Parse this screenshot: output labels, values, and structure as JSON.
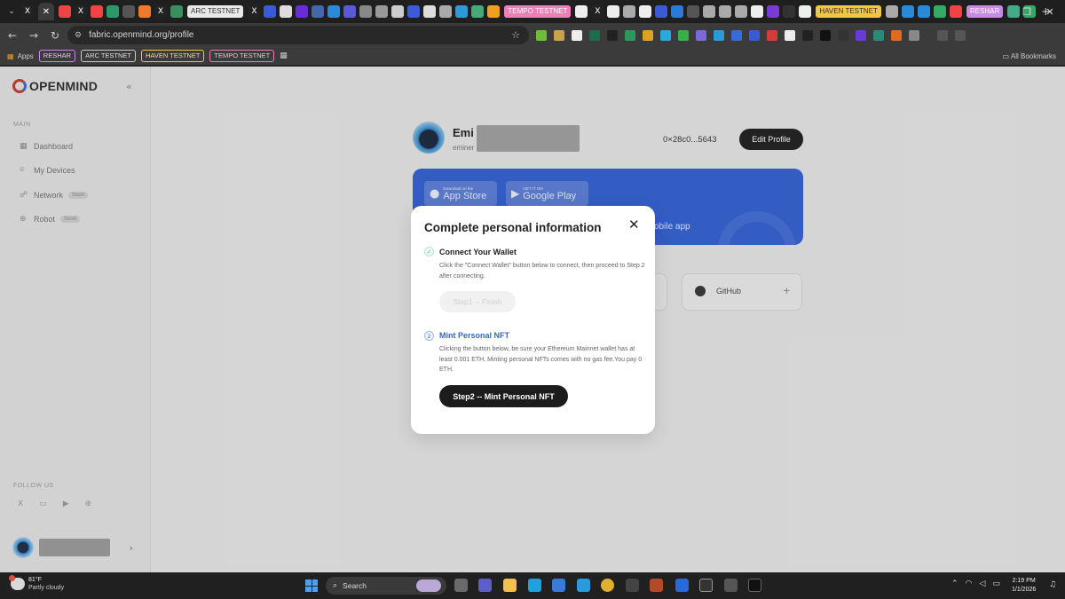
{
  "browser": {
    "tab_chips": [
      {
        "label": "ARC TESTNET",
        "bg": "#e8e8e8",
        "fg": "#333"
      },
      {
        "label": "TEMPO TESTNET",
        "bg": "#ee7fb6",
        "fg": "#fff"
      },
      {
        "label": "HAVEN TESTNET",
        "bg": "#f2c744",
        "fg": "#333"
      },
      {
        "label": "RESHAR",
        "bg": "#c98ae6",
        "fg": "#fff"
      }
    ],
    "new_tab": "+",
    "window_controls": {
      "minimize": "—",
      "restore": "❐",
      "close": "✕"
    },
    "url": "fabric.openmind.org/profile",
    "bookmarks": {
      "apps_label": "Apps",
      "items": [
        {
          "label": "RESHAR",
          "color": "#c98ae6"
        },
        {
          "label": "ARC TESTNET",
          "color": "#cccccc"
        },
        {
          "label": "HAVEN TESTNET",
          "color": "#f2c744"
        },
        {
          "label": "TEMPO TESTNET",
          "color": "#ee7fb6"
        }
      ],
      "all_bookmarks": "All Bookmarks"
    }
  },
  "sidebar": {
    "logo_text": "OPENMIND",
    "section_main": "MAIN",
    "items": [
      {
        "label": "Dashboard",
        "icon": "grid-icon",
        "badge": ""
      },
      {
        "label": "My Devices",
        "icon": "devices-icon",
        "badge": ""
      },
      {
        "label": "Network",
        "icon": "network-icon",
        "badge": "Soon"
      },
      {
        "label": "Robot",
        "icon": "robot-icon",
        "badge": "Soon"
      }
    ],
    "section_follow": "FOLLOW US"
  },
  "profile": {
    "name_visible": "Emi",
    "handle_visible": "eminer",
    "wallet_address": "0×28c0...5643",
    "edit_button": "Edit Profile"
  },
  "banner": {
    "app_store_small": "Download on the",
    "app_store_big": "App Store",
    "google_play_small": "GET IT ON",
    "google_play_big": "Google Play",
    "text_visible": "obile app"
  },
  "links": {
    "github_label": "GitHub",
    "add_symbol": "+"
  },
  "modal": {
    "title": "Complete personal information",
    "close_symbol": "✕",
    "step1": {
      "icon": "✓",
      "title": "Connect Your Wallet",
      "description": "Click the \"Connect Wallet\" button below to connect, then proceed to Step 2 after connecting.",
      "button": "Step1 -- Finish"
    },
    "step2": {
      "icon": "2",
      "title": "Mint Personal NFT",
      "description": "Clicking the button below, be sure your Ethereum Mainnet wallet has at least 0.001 ETH, Minting personal NFTs comes with no gas fee.You pay 0 ETH.",
      "button": "Step2 -- Mint Personal NFT"
    },
    "accent_step1": "#3bb87a",
    "accent_step2": "#3a66c4"
  },
  "taskbar": {
    "temperature": "81°F",
    "weather": "Partly cloudy",
    "search_label": "Search",
    "time": "2:19 PM",
    "date": "1/1/2026"
  }
}
